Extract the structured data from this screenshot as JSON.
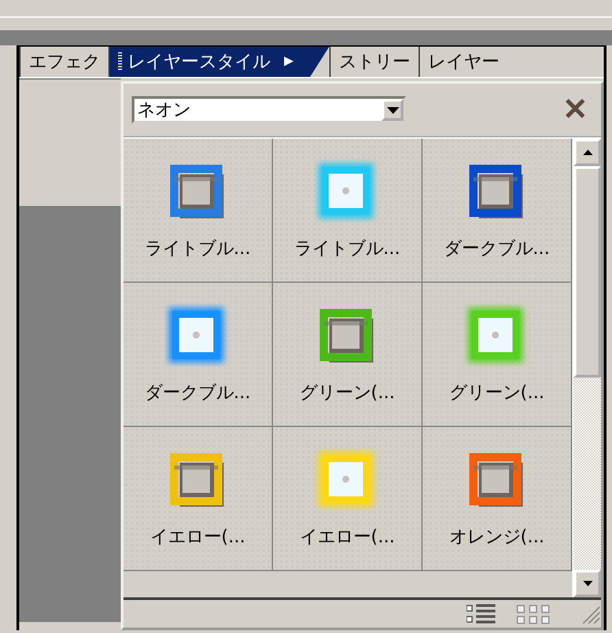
{
  "tabs": [
    {
      "label": "エフェク",
      "selected": false
    },
    {
      "label": "レイヤースタイル",
      "selected": true,
      "arrow": "▶"
    },
    {
      "label": "ストリー",
      "selected": false
    },
    {
      "label": "レイヤー",
      "selected": false
    }
  ],
  "category": {
    "value": "ネオン"
  },
  "close": "✕",
  "styles": [
    {
      "label": "ライトブル...",
      "color": "#2a7de0",
      "kind": "shadow"
    },
    {
      "label": "ライトブル...",
      "color": "#22c8f0",
      "kind": "glow"
    },
    {
      "label": "ダークブル...",
      "color": "#0a4cc8",
      "kind": "shadow"
    },
    {
      "label": "ダークブル...",
      "color": "#1890ff",
      "kind": "glow"
    },
    {
      "label": "グリーン(...",
      "color": "#4cb81a",
      "kind": "shadow"
    },
    {
      "label": "グリーン(...",
      "color": "#58d020",
      "kind": "glow"
    },
    {
      "label": "イエロー(...",
      "color": "#f0c010",
      "kind": "shadow"
    },
    {
      "label": "イエロー(...",
      "color": "#f8d818",
      "kind": "glow"
    },
    {
      "label": "オレンジ(...",
      "color": "#f06010",
      "kind": "shadow"
    }
  ]
}
